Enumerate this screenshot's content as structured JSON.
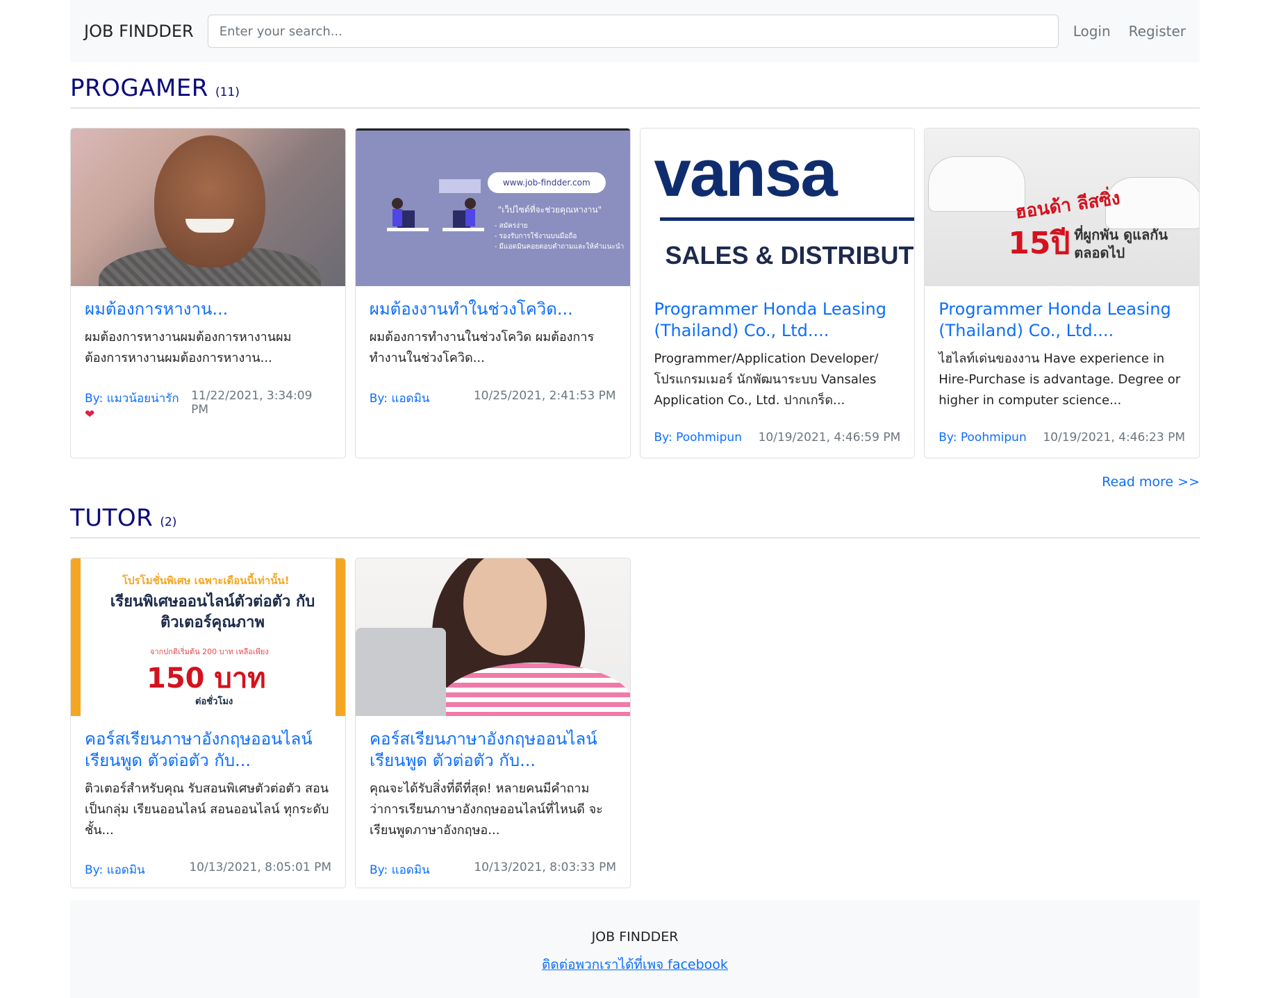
{
  "navbar": {
    "brand": "JOB FINDDER",
    "search_placeholder": "Enter your search...",
    "login": "Login",
    "register": "Register"
  },
  "sections": [
    {
      "name": "PROGAMER",
      "count": "(11)",
      "read_more": "Read more >>",
      "cards": [
        {
          "title": "ผมต้องการหางาน...",
          "text": "ผมต้องการหางานผมต้องการหางานผมต้องการหางานผมต้องการหางาน...",
          "by": "By:",
          "author": "แมวน้อยน่ารัก",
          "date": "11/22/2021, 3:34:09 PM"
        },
        {
          "title": "ผมต้องงานทำในช่วงโควิด...",
          "text": "ผมต้องการทำงานในช่วงโควิด ผมต้องการทำงานในช่วงโควิด...",
          "by": "By:",
          "author": "แอดมิน",
          "date": "10/25/2021, 2:41:53 PM",
          "img_url": "www.job-findder.com",
          "img_tagline": "\"เว็ปไซต์ที่จะช่วยคุณหางาน\"",
          "img_bullets": "- สมัครง่าย\n- รองรับการใช้งานบนมือถือ\n- มีแอดมินคอยตอบคำถามและให้คำแนะนำ"
        },
        {
          "title": "Programmer Honda Leasing (Thailand) Co., Ltd....",
          "text": "Programmer/Application Developer/ โปรแกรมเมอร์ นักพัฒนาระบบ Vansales Application Co., Ltd. ปากเกร็ด...",
          "by": "By:",
          "author": "Poohmipun",
          "date": "10/19/2021, 4:46:59 PM",
          "img_big": "vansa",
          "img_sub": "SALES & DISTRIBUTI"
        },
        {
          "title": "Programmer Honda Leasing (Thailand) Co., Ltd....",
          "text": "ไฮไลท์เด่นของงาน Have experience in Hire-Purchase is advantage. Degree or higher in computer science...",
          "by": "By:",
          "author": "Poohmipun",
          "date": "10/19/2021, 4:46:23 PM",
          "img_t1": "ฮอนด้า ลีสซิ่ง",
          "img_t2": "15ปี",
          "img_t3": "ที่ผูกพัน ดูแลกันตลอดไป"
        }
      ]
    },
    {
      "name": "TUTOR",
      "count": "(2)",
      "cards": [
        {
          "title": "คอร์สเรียนภาษาอังกฤษออนไลน์ เรียนพูด ตัวต่อตัว กับ...",
          "text": "ติวเตอร์สำหรับคุณ รับสอนพิเศษตัวต่อตัว สอนเป็นกลุ่ม เรียนออนไลน์ สอนออนไลน์ ทุกระดับชั้น...",
          "by": "By:",
          "author": "แอดมิน",
          "date": "10/13/2021, 8:05:01 PM",
          "img_a": "โปรโมชั่นพิเศษ เฉพาะเดือนนี้เท่านั้น!",
          "img_b": "เรียนพิเศษออนไลน์ตัวต่อตัว กับติวเตอร์คุณภาพ",
          "img_c": "จากปกติเริ่มต้น 200 บาท เหลือเพียง",
          "img_d": "150 บาท",
          "img_e": "ต่อชั่วโมง"
        },
        {
          "title": "คอร์สเรียนภาษาอังกฤษออนไลน์ เรียนพูด ตัวต่อตัว กับ...",
          "text": "คุณจะได้รับสิ่งที่ดีที่สุด! หลายคนมีคำถามว่าการเรียนภาษาอังกฤษออนไลน์ที่ไหนดี จะเรียนพูดภาษาอังกฤษอ...",
          "by": "By:",
          "author": "แอดมิน",
          "date": "10/13/2021, 8:03:33 PM"
        }
      ]
    }
  ],
  "footer": {
    "brand": "JOB FINDDER",
    "link": "ติดต่อพวกเราได้ที่เพจ facebook"
  },
  "colors": {
    "accent": "#0d6efd",
    "heading": "#0a0a7a",
    "navbar_bg": "#f8f9fa"
  }
}
